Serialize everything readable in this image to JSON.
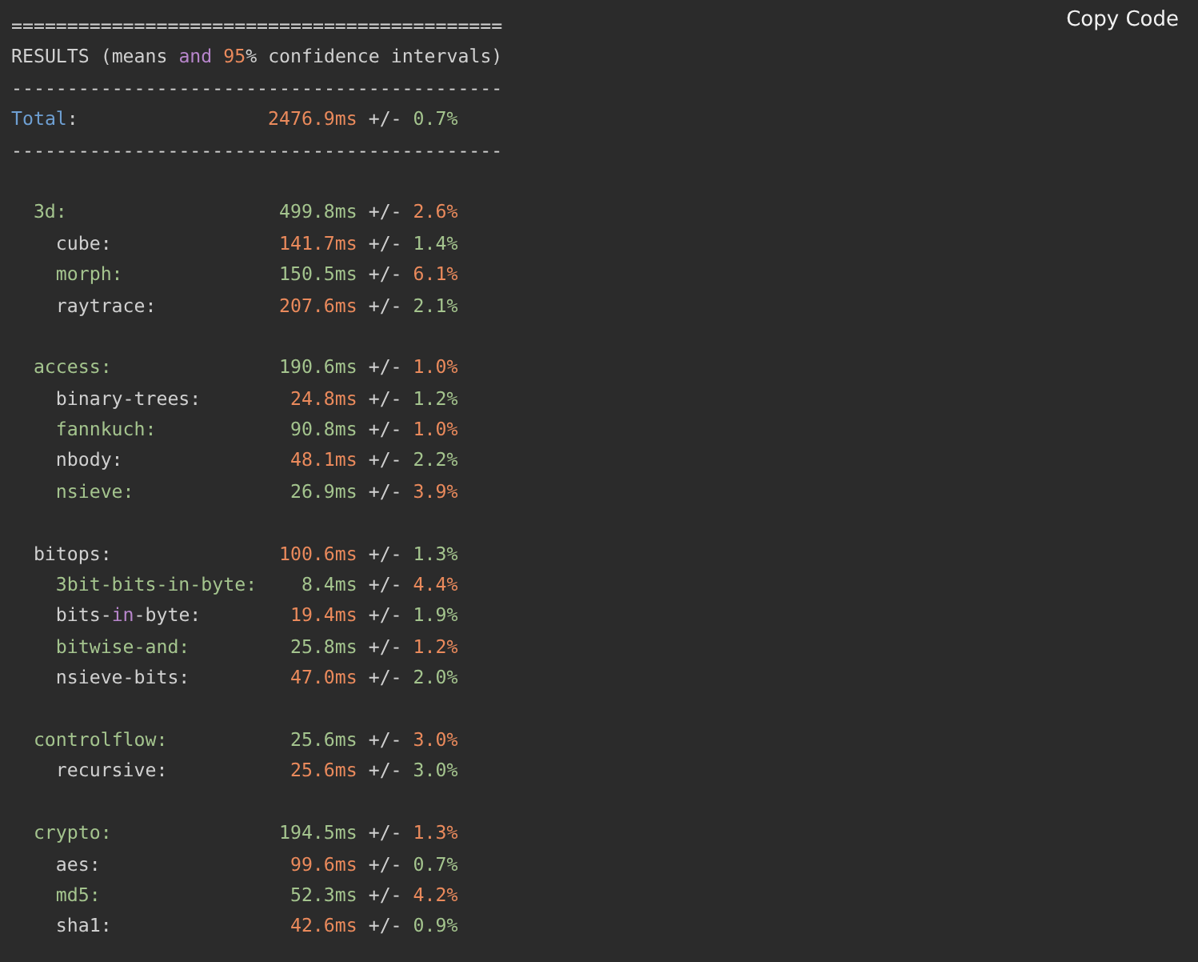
{
  "copy_button": {
    "label": "Copy Code"
  },
  "header": [
    {
      "segments": [
        {
          "text": "============================================",
          "color": "#d0d0d0"
        }
      ]
    },
    {
      "segments": [
        {
          "text": "RESULTS (means ",
          "color": "#d0d0d0"
        },
        {
          "text": "and",
          "color": "#b886cc"
        },
        {
          "text": " 95",
          "color": "#ea8a5c"
        },
        {
          "text": "% confidence intervals)",
          "color": "#d0d0d0"
        }
      ]
    },
    {
      "segments": [
        {
          "text": "--------------------------------------------",
          "color": "#d0d0d0"
        }
      ]
    }
  ],
  "total": {
    "name": [
      {
        "text": "Total",
        "color": "#6e9fd2"
      },
      {
        "text": ":",
        "color": "#d0d0d0"
      }
    ],
    "value": {
      "text": "2476.9ms",
      "color": "#ea8a5c"
    },
    "sep": "+/-",
    "pct": {
      "text": "0.7%",
      "color": "#a4c48e"
    }
  },
  "footer": [
    {
      "segments": [
        {
          "text": "--------------------------------------------",
          "color": "#d0d0d0"
        }
      ]
    }
  ],
  "groups": [
    {
      "name": [
        {
          "text": "3d:",
          "color": "#a4c48e"
        }
      ],
      "value": {
        "text": "499.8ms",
        "color": "#a4c48e"
      },
      "sep": "+/-",
      "pct": {
        "text": "2.6%",
        "color": "#ea8a5c"
      },
      "children": [
        {
          "name": [
            {
              "text": "cube:",
              "color": "#d0d0d0"
            }
          ],
          "value": {
            "text": "141.7ms",
            "color": "#ea8a5c"
          },
          "sep": "+/-",
          "pct": {
            "text": "1.4%",
            "color": "#a4c48e"
          }
        },
        {
          "name": [
            {
              "text": "morph:",
              "color": "#a4c48e"
            }
          ],
          "value": {
            "text": "150.5ms",
            "color": "#a4c48e"
          },
          "sep": "+/-",
          "pct": {
            "text": "6.1%",
            "color": "#ea8a5c"
          }
        },
        {
          "name": [
            {
              "text": "raytrace:",
              "color": "#d0d0d0"
            }
          ],
          "value": {
            "text": "207.6ms",
            "color": "#ea8a5c"
          },
          "sep": "+/-",
          "pct": {
            "text": "2.1%",
            "color": "#a4c48e"
          }
        }
      ]
    },
    {
      "name": [
        {
          "text": "access:",
          "color": "#a4c48e"
        }
      ],
      "value": {
        "text": "190.6ms",
        "color": "#a4c48e"
      },
      "sep": "+/-",
      "pct": {
        "text": "1.0%",
        "color": "#ea8a5c"
      },
      "children": [
        {
          "name": [
            {
              "text": "binary-trees:",
              "color": "#d0d0d0"
            }
          ],
          "value": {
            "text": "24.8ms",
            "color": "#ea8a5c"
          },
          "sep": "+/-",
          "pct": {
            "text": "1.2%",
            "color": "#a4c48e"
          }
        },
        {
          "name": [
            {
              "text": "fannkuch:",
              "color": "#a4c48e"
            }
          ],
          "value": {
            "text": "90.8ms",
            "color": "#a4c48e"
          },
          "sep": "+/-",
          "pct": {
            "text": "1.0%",
            "color": "#ea8a5c"
          }
        },
        {
          "name": [
            {
              "text": "nbody:",
              "color": "#d0d0d0"
            }
          ],
          "value": {
            "text": "48.1ms",
            "color": "#ea8a5c"
          },
          "sep": "+/-",
          "pct": {
            "text": "2.2%",
            "color": "#a4c48e"
          }
        },
        {
          "name": [
            {
              "text": "nsieve:",
              "color": "#a4c48e"
            }
          ],
          "value": {
            "text": "26.9ms",
            "color": "#a4c48e"
          },
          "sep": "+/-",
          "pct": {
            "text": "3.9%",
            "color": "#ea8a5c"
          }
        }
      ]
    },
    {
      "name": [
        {
          "text": "bitops:",
          "color": "#d0d0d0"
        }
      ],
      "value": {
        "text": "100.6ms",
        "color": "#ea8a5c"
      },
      "sep": "+/-",
      "pct": {
        "text": "1.3%",
        "color": "#a4c48e"
      },
      "children": [
        {
          "name": [
            {
              "text": "3bit-bits-in-byte:",
              "color": "#a4c48e"
            }
          ],
          "value": {
            "text": "8.4ms",
            "color": "#a4c48e"
          },
          "sep": "+/-",
          "pct": {
            "text": "4.4%",
            "color": "#ea8a5c"
          }
        },
        {
          "name": [
            {
              "text": "bits-",
              "color": "#d0d0d0"
            },
            {
              "text": "in",
              "color": "#b886cc"
            },
            {
              "text": "-byte:",
              "color": "#d0d0d0"
            }
          ],
          "value": {
            "text": "19.4ms",
            "color": "#ea8a5c"
          },
          "sep": "+/-",
          "pct": {
            "text": "1.9%",
            "color": "#a4c48e"
          }
        },
        {
          "name": [
            {
              "text": "bitwise-and:",
              "color": "#a4c48e"
            }
          ],
          "value": {
            "text": "25.8ms",
            "color": "#a4c48e"
          },
          "sep": "+/-",
          "pct": {
            "text": "1.2%",
            "color": "#ea8a5c"
          }
        },
        {
          "name": [
            {
              "text": "nsieve-bits:",
              "color": "#d0d0d0"
            }
          ],
          "value": {
            "text": "47.0ms",
            "color": "#ea8a5c"
          },
          "sep": "+/-",
          "pct": {
            "text": "2.0%",
            "color": "#a4c48e"
          }
        }
      ]
    },
    {
      "name": [
        {
          "text": "controlflow:",
          "color": "#a4c48e"
        }
      ],
      "value": {
        "text": "25.6ms",
        "color": "#a4c48e"
      },
      "sep": "+/-",
      "pct": {
        "text": "3.0%",
        "color": "#ea8a5c"
      },
      "children": [
        {
          "name": [
            {
              "text": "recursive:",
              "color": "#d0d0d0"
            }
          ],
          "value": {
            "text": "25.6ms",
            "color": "#ea8a5c"
          },
          "sep": "+/-",
          "pct": {
            "text": "3.0%",
            "color": "#a4c48e"
          }
        }
      ]
    },
    {
      "name": [
        {
          "text": "crypto:",
          "color": "#a4c48e"
        }
      ],
      "value": {
        "text": "194.5ms",
        "color": "#a4c48e"
      },
      "sep": "+/-",
      "pct": {
        "text": "1.3%",
        "color": "#ea8a5c"
      },
      "children": [
        {
          "name": [
            {
              "text": "aes:",
              "color": "#d0d0d0"
            }
          ],
          "value": {
            "text": "99.6ms",
            "color": "#ea8a5c"
          },
          "sep": "+/-",
          "pct": {
            "text": "0.7%",
            "color": "#a4c48e"
          }
        },
        {
          "name": [
            {
              "text": "md5:",
              "color": "#a4c48e"
            }
          ],
          "value": {
            "text": "52.3ms",
            "color": "#a4c48e"
          },
          "sep": "+/-",
          "pct": {
            "text": "4.2%",
            "color": "#ea8a5c"
          }
        },
        {
          "name": [
            {
              "text": "sha1:",
              "color": "#d0d0d0"
            }
          ],
          "value": {
            "text": "42.6ms",
            "color": "#ea8a5c"
          },
          "sep": "+/-",
          "pct": {
            "text": "0.9%",
            "color": "#a4c48e"
          }
        }
      ]
    }
  ]
}
